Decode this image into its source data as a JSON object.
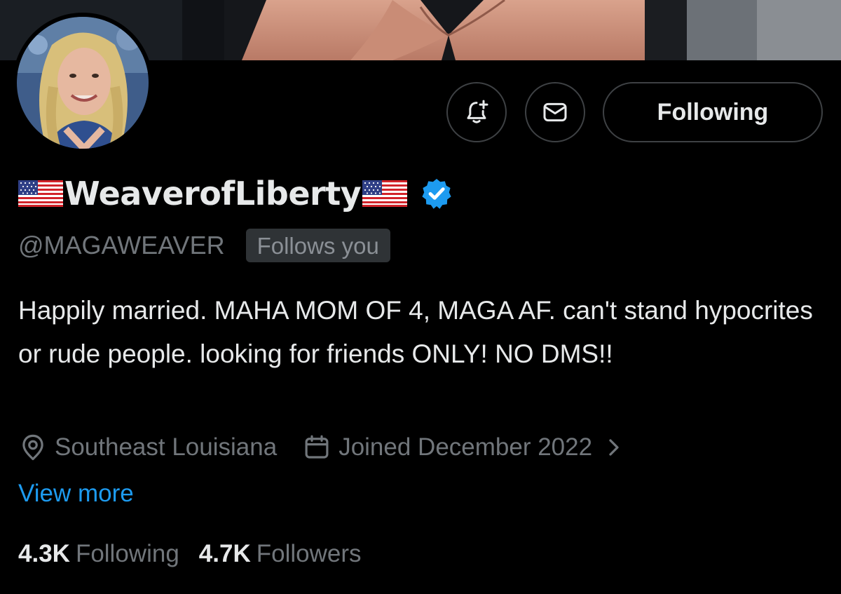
{
  "profile": {
    "display_name": "WeaverofLiberty",
    "handle": "@MAGAWEAVER",
    "follows_you_badge": "Follows you",
    "verified": true,
    "bio": "Happily married. MAHA MOM OF 4, MAGA AF. can't stand hypocrites or rude people. looking for friends ONLY! NO DMS!!",
    "location": "Southeast Louisiana",
    "joined": "Joined December 2022",
    "view_more_label": "View more"
  },
  "actions": {
    "following_label": "Following",
    "notify_icon": "bell-plus-icon",
    "message_icon": "envelope-icon"
  },
  "stats": {
    "following_count": "4.3K",
    "following_label": "Following",
    "followers_count": "4.7K",
    "followers_label": "Followers"
  },
  "colors": {
    "background": "#000000",
    "primary_text": "#e7e9ea",
    "secondary_text": "#71767b",
    "link": "#1d9bf0",
    "verified_badge": "#1d9bf0",
    "border": "#3e4144"
  }
}
